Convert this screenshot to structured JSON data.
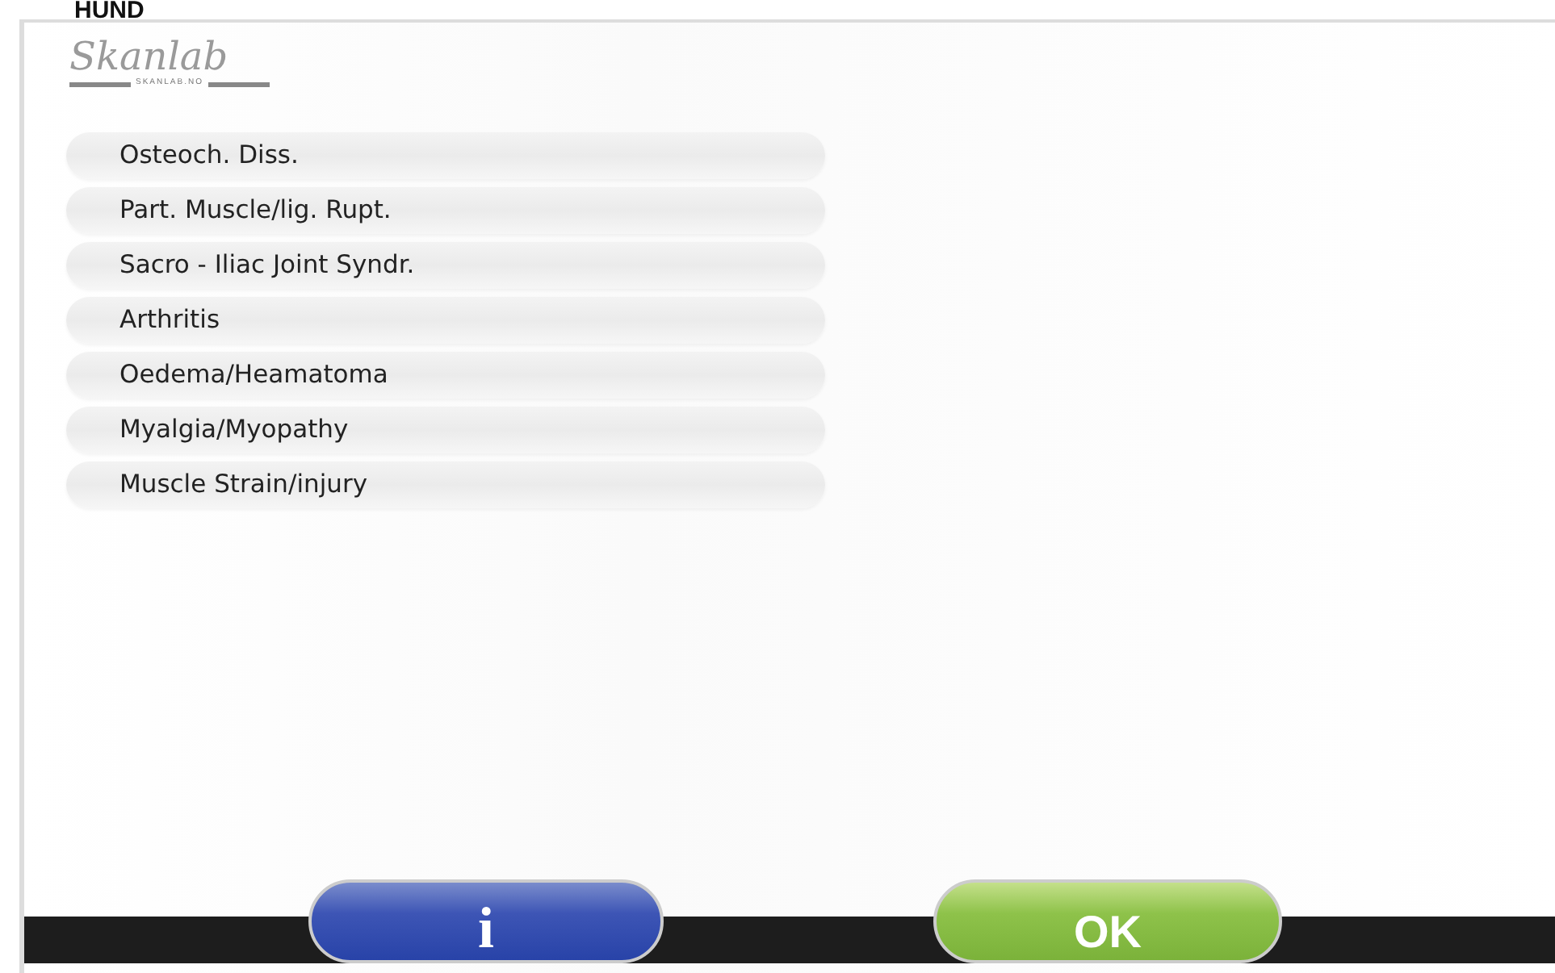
{
  "screen_title": "HUND",
  "logo": {
    "name": "Skanlab",
    "url": "SKANLAB.NO"
  },
  "diagnoses": [
    {
      "label": "Osteoch. Diss."
    },
    {
      "label": "Part. Muscle/lig. Rupt."
    },
    {
      "label": "Sacro - Iliac Joint Syndr."
    },
    {
      "label": "Arthritis"
    },
    {
      "label": "Oedema/Heamatoma"
    },
    {
      "label": "Myalgia/Myopathy"
    },
    {
      "label": "Muscle Strain/injury"
    }
  ],
  "buttons": [
    {
      "kind": "info",
      "label": "i"
    },
    {
      "kind": "ok",
      "label": "OK"
    }
  ]
}
